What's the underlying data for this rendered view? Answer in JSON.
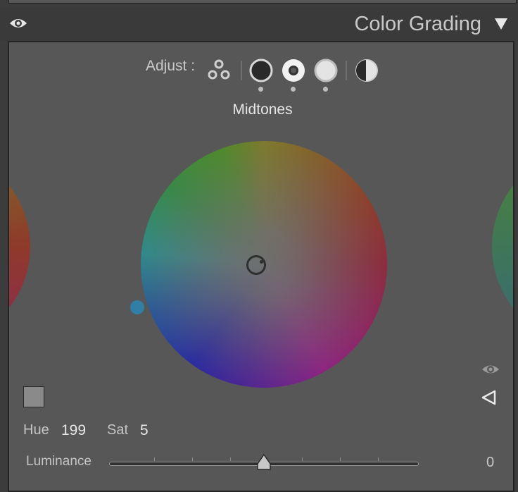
{
  "panel": {
    "title": "Color Grading"
  },
  "adjust": {
    "label": "Adjust :",
    "selected": "Midtones",
    "modes": [
      "3-way",
      "shadows",
      "midtones",
      "highlights",
      "global"
    ]
  },
  "wheel": {
    "mode_label": "Midtones"
  },
  "values": {
    "hue_label": "Hue",
    "hue": "199",
    "sat_label": "Sat",
    "sat": "5",
    "luminance_label": "Luminance",
    "luminance": "0"
  },
  "colors": {
    "panel_bg": "#575757",
    "hue_handle": "#2f7fa6",
    "swatch": "#8a8a8a"
  },
  "icons": {
    "visibility": "eye-icon",
    "collapse": "triangle-down-icon",
    "reset": "triangle-left-icon"
  }
}
